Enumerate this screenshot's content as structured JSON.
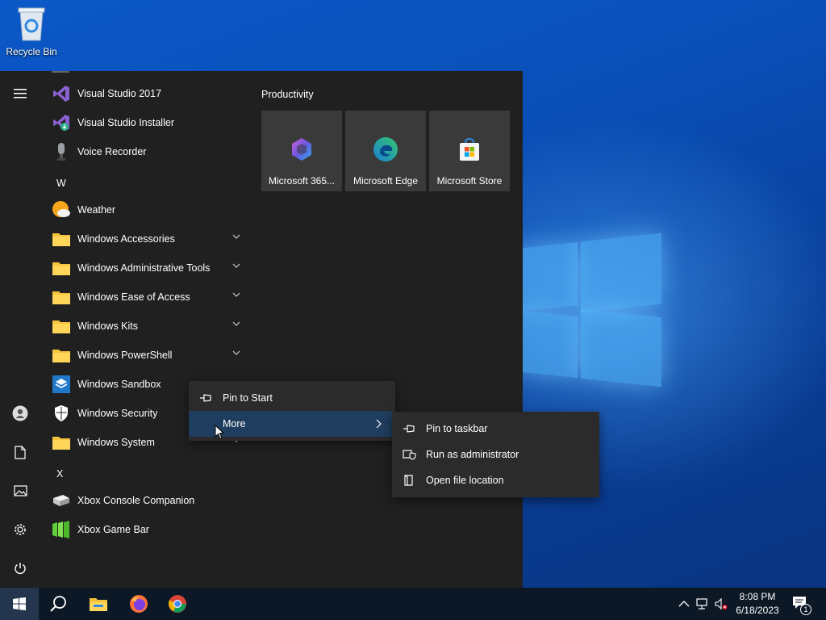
{
  "desktop": {
    "recycle_bin_label": "Recycle Bin"
  },
  "start_menu": {
    "apps": [
      {
        "name": "Visual Studio 2017",
        "icon": "visual-studio-icon",
        "kind": "app"
      },
      {
        "name": "Visual Studio Installer",
        "icon": "visual-studio-installer-icon",
        "kind": "app"
      },
      {
        "name": "Voice Recorder",
        "icon": "microphone-icon",
        "kind": "app"
      },
      {
        "letter": "W"
      },
      {
        "name": "Weather",
        "icon": "weather-icon",
        "kind": "app"
      },
      {
        "name": "Windows Accessories",
        "icon": "folder-icon",
        "kind": "folder"
      },
      {
        "name": "Windows Administrative Tools",
        "icon": "folder-icon",
        "kind": "folder"
      },
      {
        "name": "Windows Ease of Access",
        "icon": "folder-icon",
        "kind": "folder"
      },
      {
        "name": "Windows Kits",
        "icon": "folder-icon",
        "kind": "folder"
      },
      {
        "name": "Windows PowerShell",
        "icon": "folder-icon",
        "kind": "folder"
      },
      {
        "name": "Windows Sandbox",
        "icon": "sandbox-icon",
        "kind": "app"
      },
      {
        "name": "Windows Security",
        "icon": "shield-icon",
        "kind": "app"
      },
      {
        "name": "Windows System",
        "icon": "folder-icon",
        "kind": "folder"
      },
      {
        "letter": "X"
      },
      {
        "name": "Xbox Console Companion",
        "icon": "xbox-console-icon",
        "kind": "app"
      },
      {
        "name": "Xbox Game Bar",
        "icon": "xbox-game-bar-icon",
        "kind": "app"
      }
    ],
    "tiles_group_title": "Productivity",
    "tiles": [
      {
        "label": "Microsoft 365...",
        "icon": "microsoft-365-icon"
      },
      {
        "label": "Microsoft Edge",
        "icon": "edge-icon"
      },
      {
        "label": "Microsoft Store",
        "icon": "store-icon"
      }
    ],
    "rail_icons": [
      "hamburger-menu-icon",
      "user-icon",
      "documents-icon",
      "pictures-icon",
      "settings-icon",
      "power-icon"
    ]
  },
  "context_menu": {
    "items": [
      {
        "label": "Pin to Start",
        "icon": "pin-icon"
      },
      {
        "label": "More",
        "icon": "",
        "highlighted": true
      }
    ]
  },
  "submenu": {
    "items": [
      {
        "label": "Pin to taskbar",
        "icon": "pin-icon"
      },
      {
        "label": "Run as administrator",
        "icon": "admin-shield-icon"
      },
      {
        "label": "Open file location",
        "icon": "file-location-icon"
      }
    ]
  },
  "taskbar": {
    "pinned": [
      "windows-start-icon",
      "search-icon",
      "file-explorer-icon",
      "firefox-icon",
      "chrome-icon"
    ],
    "time": "8:08 PM",
    "date": "6/18/2023",
    "notification_count": "1"
  },
  "colors": {
    "start_bg": "#202020",
    "tile_bg": "#3a3a3a",
    "context_bg": "#2b2b2b",
    "highlight": "#1f3d5e",
    "taskbar_bg": "#0c1826"
  }
}
